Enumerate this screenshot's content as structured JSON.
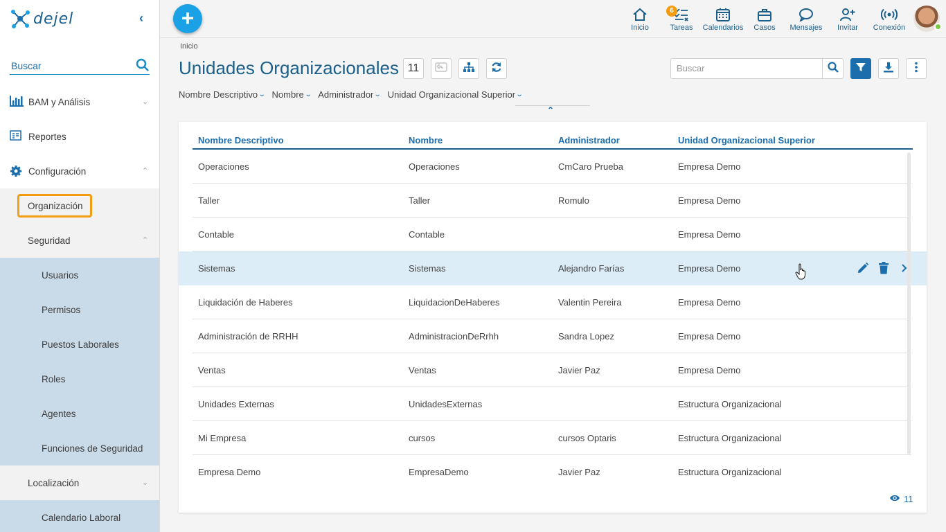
{
  "sidebar": {
    "logo": "dejel",
    "search_placeholder": "Buscar",
    "items": [
      {
        "label": "BAM y Análisis",
        "icon": "bar-chart-icon"
      },
      {
        "label": "Reportes",
        "icon": "report-icon"
      },
      {
        "label": "Configuración",
        "icon": "gear-icon"
      },
      {
        "label": "Organización"
      },
      {
        "label": "Seguridad"
      },
      {
        "label": "Usuarios"
      },
      {
        "label": "Permisos"
      },
      {
        "label": "Puestos Laborales"
      },
      {
        "label": "Roles"
      },
      {
        "label": "Agentes"
      },
      {
        "label": "Funciones de Seguridad"
      },
      {
        "label": "Localización"
      },
      {
        "label": "Calendario Laboral"
      }
    ]
  },
  "topbar": {
    "nav": [
      {
        "label": "Inicio",
        "icon": "home-icon"
      },
      {
        "label": "Tareas",
        "icon": "tasks-icon",
        "badge": "6"
      },
      {
        "label": "Calendarios",
        "icon": "calendar-icon"
      },
      {
        "label": "Casos",
        "icon": "briefcase-icon"
      },
      {
        "label": "Mensajes",
        "icon": "chat-icon"
      },
      {
        "label": "Invitar",
        "icon": "add-user-icon"
      },
      {
        "label": "Conexión",
        "icon": "signal-icon"
      }
    ]
  },
  "main": {
    "breadcrumb": "Inicio",
    "title": "Unidades Organizacionales",
    "count": "11",
    "search_placeholder": "Buscar",
    "column_filters": [
      "Nombre Descriptivo",
      "Nombre",
      "Administrador",
      "Unidad Organizacional Superior"
    ],
    "table": {
      "headers": [
        "Nombre Descriptivo",
        "Nombre",
        "Administrador",
        "Unidad Organizacional Superior"
      ],
      "rows": [
        [
          "Operaciones",
          "Operaciones",
          "CmCaro Prueba",
          "Empresa Demo"
        ],
        [
          "Taller",
          "Taller",
          "Romulo",
          "Empresa Demo"
        ],
        [
          "Contable",
          "Contable",
          "",
          "Empresa Demo"
        ],
        [
          "Sistemas",
          "Sistemas",
          "Alejandro Farías",
          "Empresa Demo"
        ],
        [
          "Liquidación de Haberes",
          "LiquidacionDeHaberes",
          "Valentin Pereira",
          "Empresa Demo"
        ],
        [
          "Administración de RRHH",
          "AdministracionDeRrhh",
          "Sandra Lopez",
          "Empresa Demo"
        ],
        [
          "Ventas",
          "Ventas",
          "Javier Paz",
          "Empresa Demo"
        ],
        [
          "Unidades Externas",
          "UnidadesExternas",
          "",
          "Estructura Organizacional"
        ],
        [
          "Mi Empresa",
          "cursos",
          "cursos Optaris",
          "Estructura Organizacional"
        ],
        [
          "Empresa Demo",
          "EmpresaDemo",
          "Javier Paz",
          "Estructura Organizacional"
        ]
      ],
      "highlighted_row": 3
    },
    "footer_count": "11"
  },
  "colors": {
    "primary": "#1b6dac",
    "title": "#1b5f8c",
    "add_button": "#1ba1e6",
    "highlight_box": "#f39c12",
    "selected_row": "#dcedf7",
    "submenu_bg": "#c9dae8"
  }
}
